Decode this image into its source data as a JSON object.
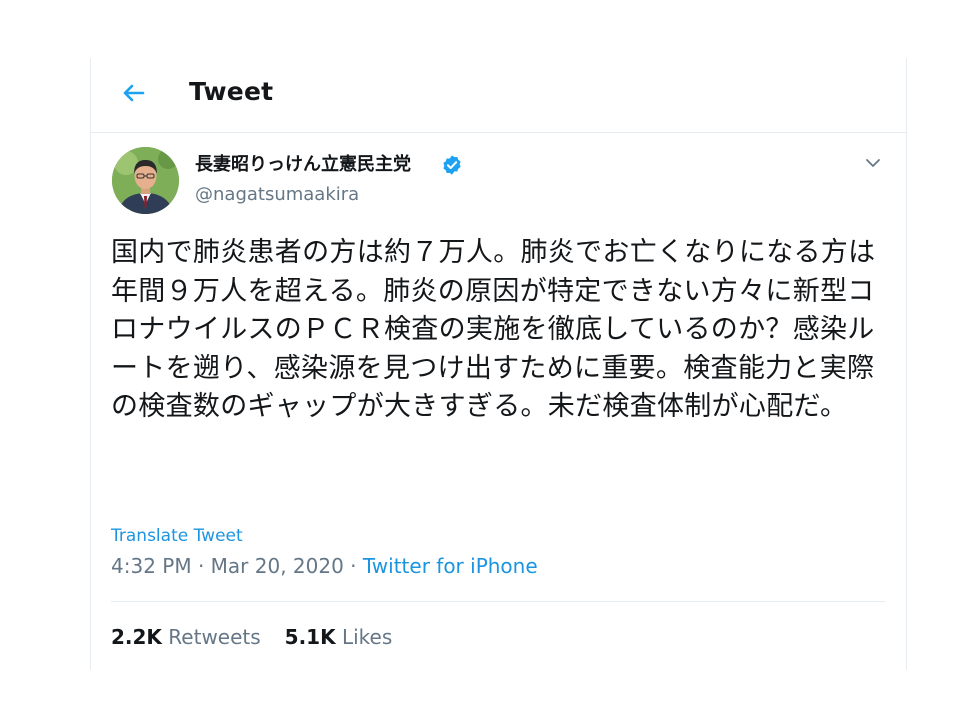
{
  "header": {
    "title": "Tweet",
    "back_icon": "arrow-left-icon"
  },
  "author": {
    "display_name": "長妻昭りっけん立憲民主党",
    "handle": "@nagatsumaakira",
    "verified_icon": "verified-badge-icon"
  },
  "tweet": {
    "text": "国内で肺炎患者の方は約７万人。肺炎でお亡くなりになる方は年間９万人を超える。肺炎の原因が特定できない方々に新型コロナウイルスのＰＣＲ検査の実施を徹底しているのか？感染ルートを遡り、感染源を見つけ出すために重要。検査能力と実際の検査数のギャップが大きすぎる。未だ検査体制が心配だ。",
    "translate_label": "Translate Tweet",
    "timestamp": "4:32 PM · Mar 20, 2020 · ",
    "source": "Twitter for iPhone"
  },
  "stats": {
    "retweets_count": "2.2K",
    "retweets_label": " Retweets",
    "likes_count": "5.1K",
    "likes_label": " Likes"
  },
  "colors": {
    "accent": "#1da1f2",
    "text_primary": "#14171a",
    "text_secondary": "#657786",
    "border": "#e6ecf0"
  }
}
